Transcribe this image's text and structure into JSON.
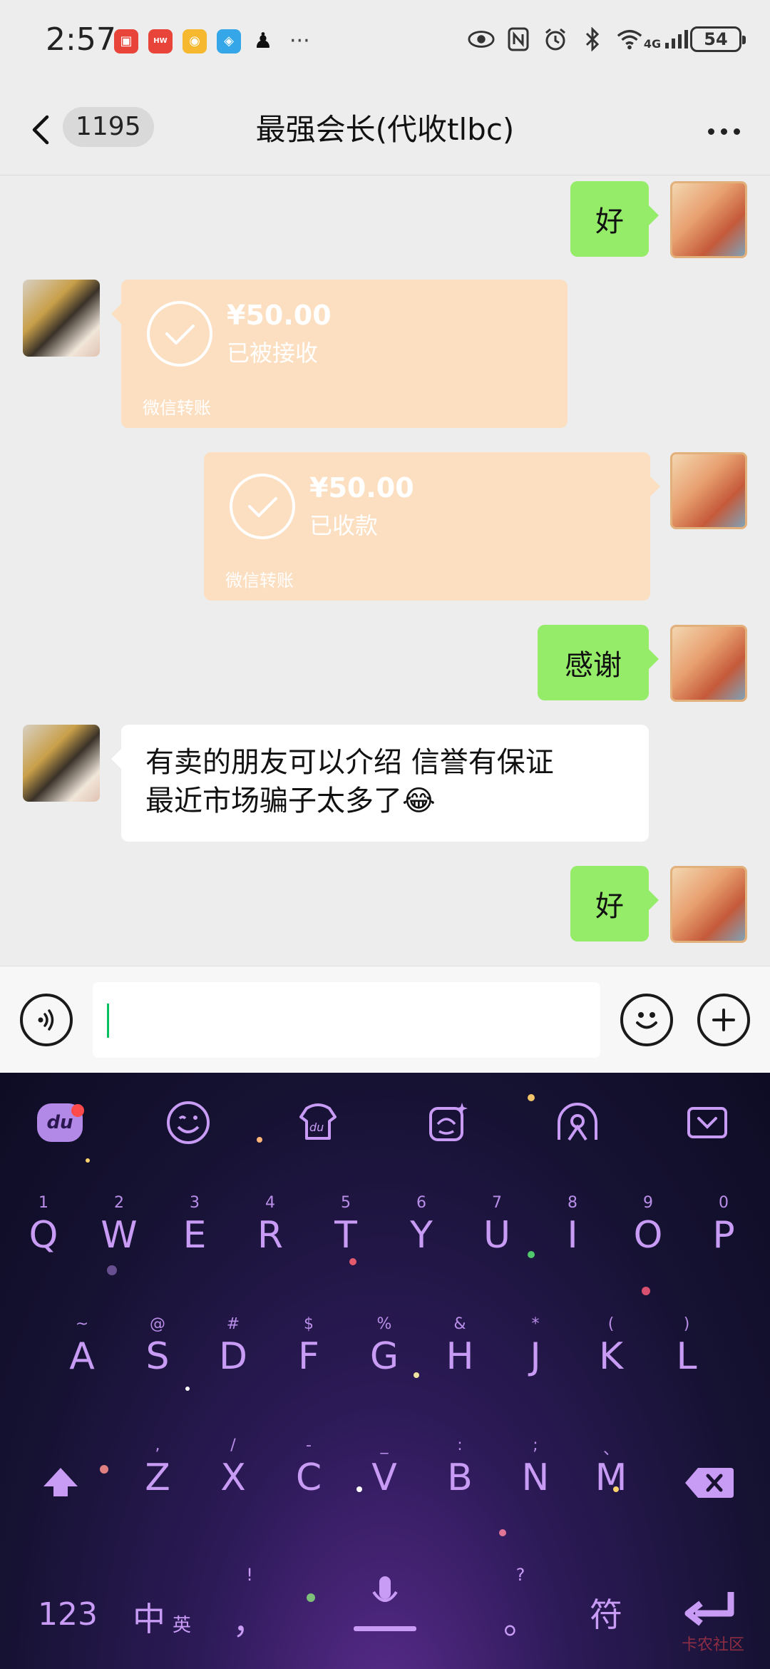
{
  "status_bar": {
    "time": "2:57",
    "notification_icons": [
      "huawei-store-icon",
      "huawei-app-icon",
      "weibo-icon",
      "blue-app-icon",
      "qq-icon"
    ],
    "more": "···",
    "network_label": "4G",
    "battery": "54"
  },
  "header": {
    "unread_count": "1195",
    "title": "最强会长(代收tlbc)"
  },
  "messages": [
    {
      "from": "self",
      "type": "text",
      "text": "好"
    },
    {
      "from": "other",
      "type": "transfer",
      "amount": "¥50.00",
      "status": "已被接收",
      "footer": "微信转账"
    },
    {
      "from": "self",
      "type": "transfer",
      "amount": "¥50.00",
      "status": "已收款",
      "footer": "微信转账"
    },
    {
      "from": "self",
      "type": "text",
      "text": "感谢"
    },
    {
      "from": "other",
      "type": "text",
      "line1": "有卖的朋友可以介绍  信誉有保证",
      "line2": "最近市场骗子太多了",
      "emoji": "😂"
    },
    {
      "from": "self",
      "type": "text",
      "text": "好"
    }
  ],
  "input_bar": {
    "value": ""
  },
  "keyboard": {
    "toolbar": [
      "du-logo-icon",
      "emoji-icon",
      "skin-icon",
      "sticker-icon",
      "assistant-icon",
      "collapse-keyboard-icon"
    ],
    "toolbar_logo_text": "du",
    "row1": [
      {
        "key": "Q",
        "sub": "1"
      },
      {
        "key": "W",
        "sub": "2"
      },
      {
        "key": "E",
        "sub": "3"
      },
      {
        "key": "R",
        "sub": "4"
      },
      {
        "key": "T",
        "sub": "5"
      },
      {
        "key": "Y",
        "sub": "6"
      },
      {
        "key": "U",
        "sub": "7"
      },
      {
        "key": "I",
        "sub": "8"
      },
      {
        "key": "O",
        "sub": "9"
      },
      {
        "key": "P",
        "sub": "0"
      }
    ],
    "row2": [
      {
        "key": "A",
        "sub": "~"
      },
      {
        "key": "S",
        "sub": "@"
      },
      {
        "key": "D",
        "sub": "#"
      },
      {
        "key": "F",
        "sub": "$"
      },
      {
        "key": "G",
        "sub": "%"
      },
      {
        "key": "H",
        "sub": "&"
      },
      {
        "key": "J",
        "sub": "*"
      },
      {
        "key": "K",
        "sub": "("
      },
      {
        "key": "L",
        "sub": ")"
      }
    ],
    "row3": [
      {
        "key": "Z",
        "sub": ","
      },
      {
        "key": "X",
        "sub": "/"
      },
      {
        "key": "C",
        "sub": "-"
      },
      {
        "key": "V",
        "sub": "_"
      },
      {
        "key": "B",
        "sub": ":"
      },
      {
        "key": "N",
        "sub": ";"
      },
      {
        "key": "M",
        "sub": "、"
      }
    ],
    "bottom": {
      "numbers": "123",
      "lang_main": "中",
      "lang_sub": "英",
      "comma": "，",
      "comma_sub": "!",
      "period": "。",
      "period_sub": "?",
      "symbols": "符"
    },
    "watermark": "卡农社区"
  }
}
